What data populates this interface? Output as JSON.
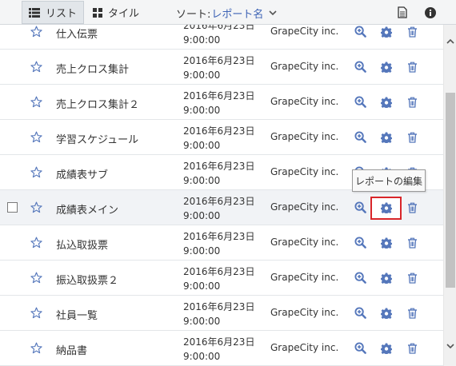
{
  "toolbar": {
    "list_label": "リスト",
    "tile_label": "タイル",
    "sort_label": "ソート:",
    "sort_value": "レポート名",
    "icons": [
      "list-icon",
      "tile-icon",
      "chevron-down-icon",
      "document-icon",
      "info-icon"
    ]
  },
  "tooltip": "レポートの編集",
  "rows": [
    {
      "name": "仕入伝票",
      "date": "2016年6月23日",
      "time": "9:00:00",
      "owner": "GrapeCity inc."
    },
    {
      "name": "売上クロス集計",
      "date": "2016年6月23日",
      "time": "9:00:00",
      "owner": "GrapeCity inc."
    },
    {
      "name": "売上クロス集計２",
      "date": "2016年6月23日",
      "time": "9:00:00",
      "owner": "GrapeCity inc."
    },
    {
      "name": "学習スケジュール",
      "date": "2016年6月23日",
      "time": "9:00:00",
      "owner": "GrapeCity inc."
    },
    {
      "name": "成績表サブ",
      "date": "2016年6月23日",
      "time": "9:00:00",
      "owner": "GrapeCity inc."
    },
    {
      "name": "成績表メイン",
      "date": "2016年6月23日",
      "time": "9:00:00",
      "owner": "GrapeCity inc."
    },
    {
      "name": "払込取扱票",
      "date": "2016年6月23日",
      "time": "9:00:00",
      "owner": "GrapeCity inc."
    },
    {
      "name": "振込取扱票２",
      "date": "2016年6月23日",
      "time": "9:00:00",
      "owner": "GrapeCity inc."
    },
    {
      "name": "社員一覧",
      "date": "2016年6月23日",
      "time": "9:00:00",
      "owner": "GrapeCity inc."
    },
    {
      "name": "納品書",
      "date": "2016年6月23日",
      "time": "9:00:00",
      "owner": "GrapeCity inc."
    }
  ],
  "colors": {
    "accent": "#3d63b5",
    "icon": "#5577bb",
    "highlight": "#d9262a",
    "row_hover": "#f1f3f6",
    "toolbar_bg": "#f4f5f6"
  }
}
